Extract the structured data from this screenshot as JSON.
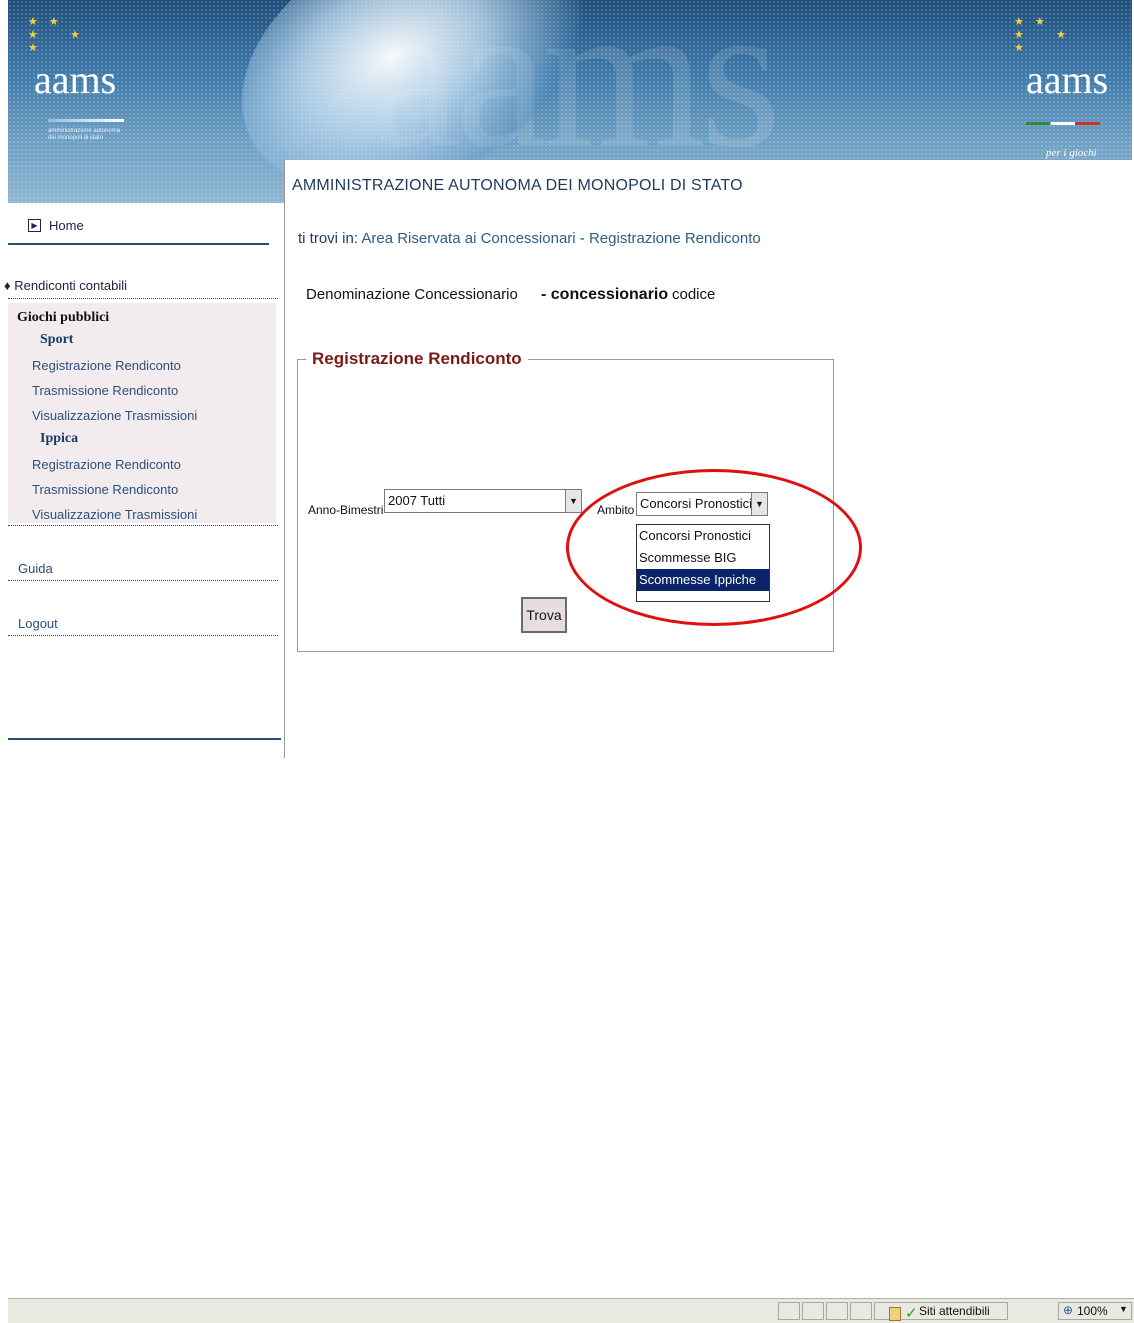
{
  "header": {
    "logo_left_word": "aams",
    "logo_left_sub": "amministrazione autonoma dei monopoli di stato",
    "logo_right_word": "aams",
    "logo_right_tagline": "per i giochi"
  },
  "sidebar": {
    "home_label": "Home",
    "section_title": "Rendiconti contabili",
    "group_label": "Giochi pubblici",
    "sport": {
      "label": "Sport",
      "items": [
        "Registrazione Rendiconto",
        "Trasmissione Rendiconto",
        "Visualizzazione Trasmissioni"
      ]
    },
    "ippica": {
      "label": "Ippica",
      "items": [
        "Registrazione Rendiconto",
        "Trasmissione Rendiconto",
        "Visualizzazione Trasmissioni"
      ]
    },
    "guida_label": "Guida",
    "logout_label": "Logout"
  },
  "main": {
    "org_title": "AMMINISTRAZIONE AUTONOMA DEI MONOPOLI DI STATO",
    "breadcrumb": {
      "prefix": "ti trovi in:",
      "area": "Area Riservata ai Concessionari",
      "separator": " - ",
      "page": "Registrazione Rendiconto"
    },
    "denominazione_label": "Denominazione Concessionario",
    "concessionario_value": "- concessionario",
    "codice_value": "codice",
    "form": {
      "legend": "Registrazione Rendiconto",
      "anno_label": "Anno-Bimestri",
      "anno_value": "2007 Tutti",
      "ambito_label": "Ambito",
      "ambito_value": "Concorsi Pronostici",
      "ambito_options": [
        "Concorsi Pronostici",
        "Scommesse BIG",
        "Scommesse Ippiche"
      ],
      "ambito_highlighted": "Scommesse Ippiche",
      "submit_label": "Trova"
    }
  },
  "statusbar": {
    "zone_text": "Siti attendibili",
    "zoom_text": "100%"
  },
  "colors": {
    "banner": "#3d78a8",
    "title_blue": "#1e3a5f",
    "legend_red": "#7a1a1a",
    "highlight_red": "#e01010",
    "selected_option": "#0a246a"
  }
}
